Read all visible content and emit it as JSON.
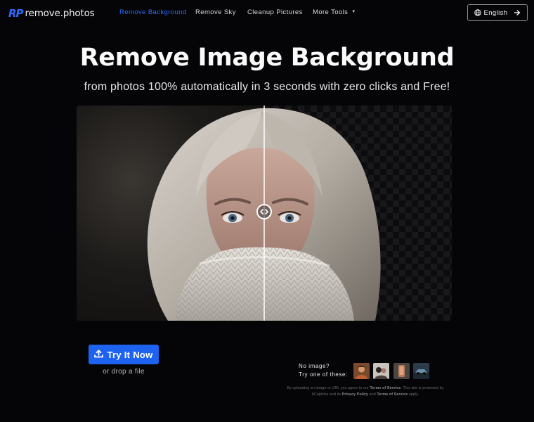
{
  "nav": {
    "logo_mark": "RP",
    "logo_text": "remove.photos",
    "links": [
      {
        "label": "Remove Background",
        "active": true
      },
      {
        "label": "Remove Sky",
        "active": false
      },
      {
        "label": "Cleanup Pictures",
        "active": false
      },
      {
        "label": "More Tools",
        "active": false
      }
    ],
    "language_button": "English",
    "icons": {
      "language": "globe-icon",
      "more_tools": "caret-down-icon",
      "language_go": "arrow-right-icon"
    }
  },
  "hero": {
    "title": "Remove Image Background",
    "subtitle": "from photos 100% automatically in 3 seconds with zero clicks and Free!"
  },
  "compare": {
    "split_fraction": 0.5,
    "handle_icon": "left-right-arrows-icon"
  },
  "cta": {
    "button_label": "Try It Now",
    "button_icon": "upload-icon",
    "drop_text": "or drop a file"
  },
  "samples": {
    "line1": "No image?",
    "line2": "Try one of these:"
  },
  "legal": {
    "part1": "By uploading an image or URL you agree to our ",
    "tos1": "Terms of Service",
    "part2": ". This site is protected by hCaptcha and its ",
    "privacy": "Privacy Policy",
    "part3": " and ",
    "tos2": "Terms of Service",
    "part4": " apply."
  },
  "colors": {
    "background": "#050507",
    "accent": "#2f6bff",
    "button": "#1e63f0"
  }
}
